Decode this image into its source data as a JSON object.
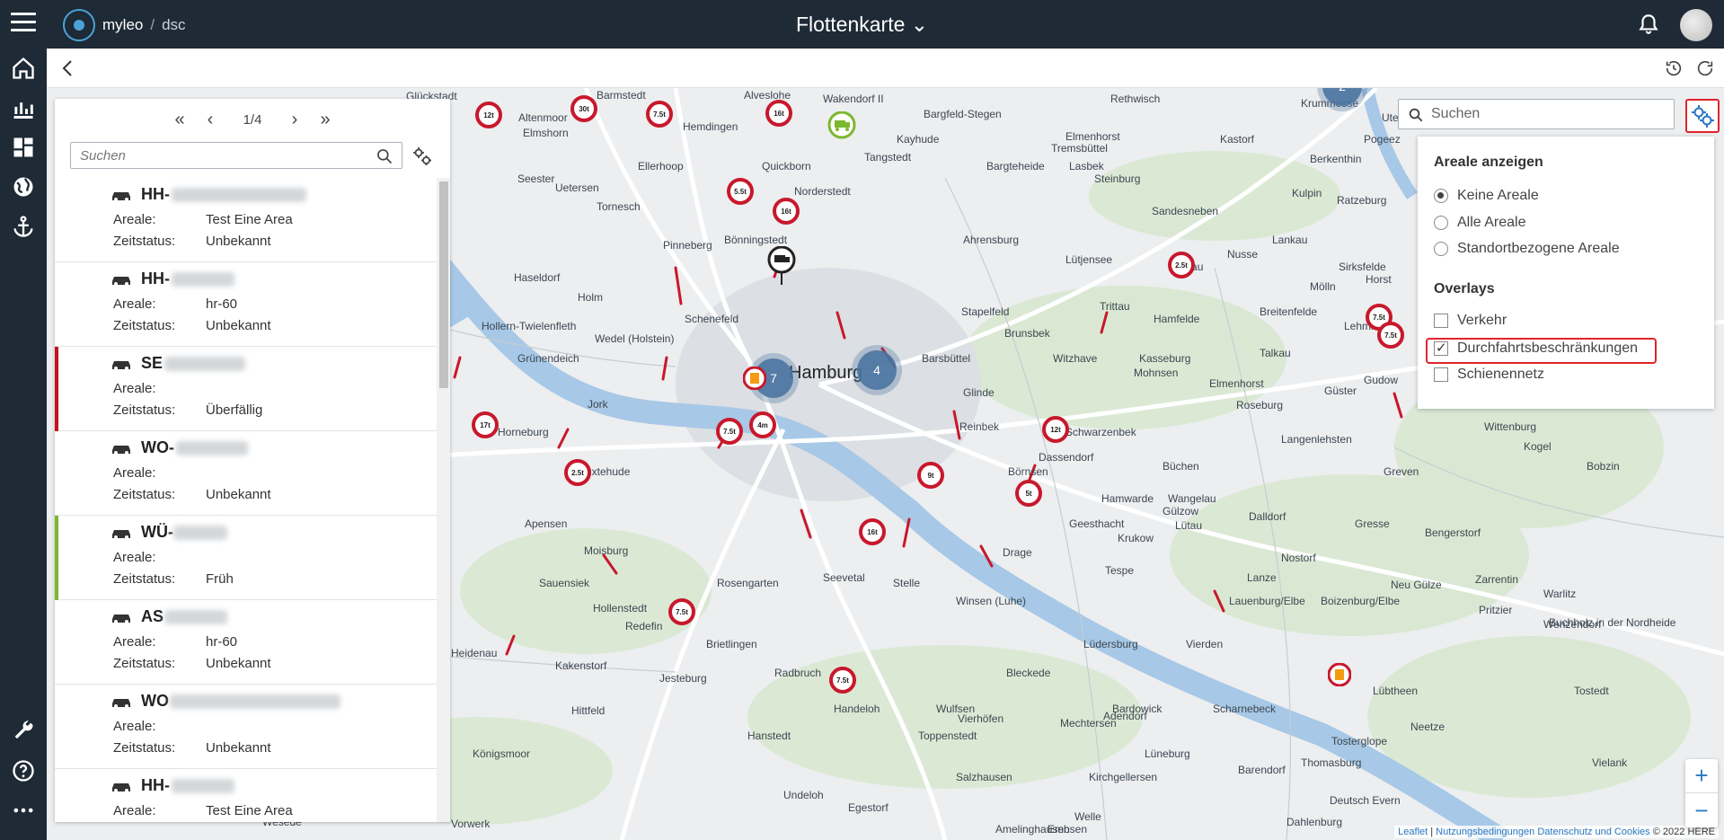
{
  "header": {
    "brand_name": "myleo",
    "brand_sep": "/",
    "brand_sub": "dsc",
    "title": "Flottenkarte ⌄"
  },
  "colors": {
    "topbar": "#1e2a36",
    "accent": "#e0242c",
    "stripe_red": "#c8101e",
    "stripe_green": "#7cb82f",
    "cluster": "#4a74a0"
  },
  "list": {
    "pager": {
      "first": "«",
      "prev": "‹",
      "info": "1/4",
      "next": "›",
      "last": "»"
    },
    "search_placeholder": "Suchen",
    "areale_label": "Areale:",
    "zeitstatus_label": "Zeitstatus:",
    "items": [
      {
        "plate": "HH-",
        "areale": "Test Eine Area",
        "zeitstatus": "Unbekannt",
        "stripe": ""
      },
      {
        "plate": "HH-",
        "areale": "hr-60",
        "zeitstatus": "Unbekannt",
        "stripe": ""
      },
      {
        "plate": "SE",
        "areale": "",
        "zeitstatus": "Überfällig",
        "stripe": "#c8101e"
      },
      {
        "plate": "WO-",
        "areale": "",
        "zeitstatus": "Unbekannt",
        "stripe": ""
      },
      {
        "plate": "WÜ-",
        "areale": "",
        "zeitstatus": "Früh",
        "stripe": "#7cb82f"
      },
      {
        "plate": "AS",
        "areale": "hr-60",
        "zeitstatus": "Unbekannt",
        "stripe": ""
      },
      {
        "plate": "WO",
        "areale": "",
        "zeitstatus": "Unbekannt",
        "stripe": ""
      },
      {
        "plate": "HH-",
        "areale": "Test Eine Area",
        "zeitstatus": "",
        "stripe": ""
      }
    ]
  },
  "map_search": {
    "placeholder": "Suchen"
  },
  "overlay_panel": {
    "areale_heading": "Areale anzeigen",
    "areale_options": [
      {
        "label": "Keine Areale",
        "selected": true
      },
      {
        "label": "Alle Areale",
        "selected": false
      },
      {
        "label": "Standortbezogene Areale",
        "selected": false
      }
    ],
    "overlays_heading": "Overlays",
    "overlay_options": [
      {
        "label": "Verkehr",
        "checked": false
      },
      {
        "label": "Durchfahrtsbeschränkungen",
        "checked": true
      },
      {
        "label": "Schienennetz",
        "checked": false
      }
    ]
  },
  "map": {
    "city_label": "Hamburg",
    "place_labels": [
      "Glückstadt",
      "Barmstedt",
      "Alveslohe",
      "Wakendorf II",
      "Rethwisch",
      "Krummesse",
      "Utecht",
      "Altenmoor",
      "Elmshorn",
      "Hemdingen",
      "Bargfeld-Stegen",
      "Kayhude",
      "Elmenhorst",
      "Bargteheide",
      "Tremsbüttel",
      "Kastorf",
      "Pogeez",
      "Berkenthin",
      "Seester",
      "Ellerhoop",
      "Quickborn",
      "Tangstedt",
      "Lasbek",
      "Steinburg",
      "Kulpin",
      "Ratzeburg",
      "Uetersen",
      "Tornesch",
      "Norderstedt",
      "Sandesneben",
      "Bönningstedt",
      "Pinneberg",
      "Ahrensburg",
      "Lankau",
      "Haseldorf",
      "Lütjensee",
      "Linau",
      "Sirksfelde",
      "Nusse",
      "Holm",
      "Mölln",
      "Horst",
      "Schenefeld",
      "Stapelfeld",
      "Trittau",
      "Hamfelde",
      "Breitenfelde",
      "Lehmrade",
      "Hollern-Twielenfleth",
      "Wedel (Holstein)",
      "Brunsbek",
      "Grünendeich",
      "Barsbüttel",
      "Witzhave",
      "Kasseburg",
      "Talkau",
      "Mohnsen",
      "Elmenhorst",
      "Güster",
      "Gudow",
      "Jork",
      "Glinde",
      "Roseburg",
      "Wittenburg",
      "Horneburg",
      "Reinbek",
      "Schwarzenbek",
      "Langenlehsten",
      "Kogel",
      "Buxtehude",
      "Dassendorf",
      "Büchen",
      "Greven",
      "Bobzin",
      "Börnsen",
      "Hamwarde",
      "Wangelau",
      "Apensen",
      "Geesthacht",
      "Gülzow",
      "Dalldorf",
      "Krukow",
      "Lütau",
      "Gresse",
      "Bengerstorf",
      "Moisburg",
      "Drage",
      "Tespe",
      "Nostorf",
      "Sauensiek",
      "Rosengarten",
      "Stelle",
      "Lanze",
      "Neu Gülze",
      "Zarrentin",
      "Hollenstedt",
      "Seevetal",
      "Winsen (Luhe)",
      "Lauenburg/Elbe",
      "Boizenburg/Elbe",
      "Pritzier",
      "Warlitz",
      "Wenzendorf",
      "Redefin",
      "Buchholz in der Nordheide",
      "Brietlingen",
      "Lüdersburg",
      "Vierden",
      "Heidenau",
      "Kakenstorf",
      "Jesteburg",
      "Radbruch",
      "Bleckede",
      "Lübtheen",
      "Tostedt",
      "Hittfeld",
      "Handeloh",
      "Wulfsen",
      "Vierhöfen",
      "Bardowick",
      "Scharnebeck",
      "Mechtersen",
      "Adendorf",
      "Neetze",
      "Tosterglope",
      "Königsmoor",
      "Hanstedt",
      "Toppenstedt",
      "Lüneburg",
      "Thomasburg",
      "Vielank",
      "Salzhausen",
      "Kirchgellersen",
      "Barendorf",
      "Undeloh",
      "Egestorf",
      "Deutsch Evern",
      "Dahlenburg",
      "Vorwerk",
      "Amelinghausen",
      "Embsen",
      "Welle",
      "Wesede",
      "Westerholz"
    ],
    "signs": [
      "12t",
      "30t",
      "7.5t",
      "16t",
      "5.5t",
      "16t",
      "2.5t",
      "7.5t",
      "17t",
      "7.5t",
      "2.5t",
      "4m",
      "12t",
      "9t",
      "5t",
      "16t",
      "7.5t",
      "7.5t",
      "7.5t"
    ],
    "clusters": [
      "7",
      "4",
      "2"
    ]
  },
  "zoom": {
    "in": "+",
    "out": "−"
  },
  "attribution": {
    "leaflet": "Leaflet",
    "sep": "|",
    "terms": "Nutzungsbedingungen",
    "privacy": "Datenschutz und Cookies",
    "copyright": "© 2022 HERE"
  }
}
